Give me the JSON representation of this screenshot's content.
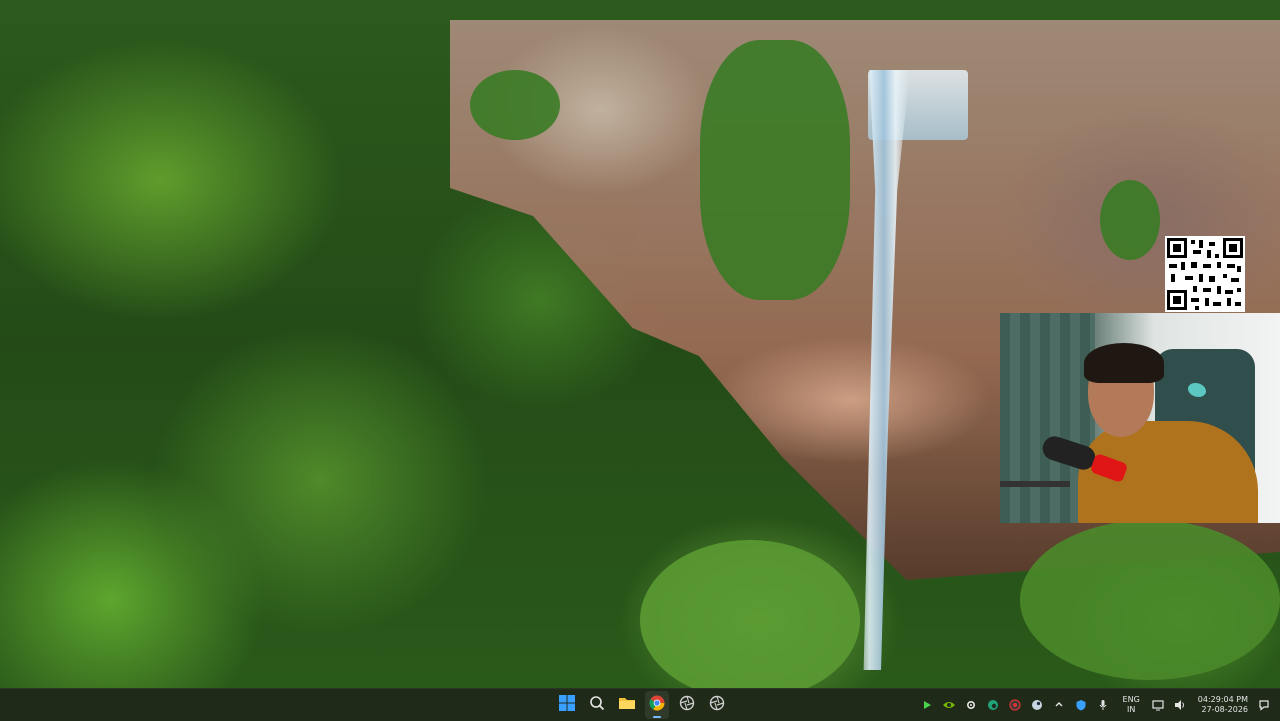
{
  "desktop": {
    "wallpaper": "waterfall-forest",
    "overlays": {
      "qr_code": "qr-code",
      "webcam": "webcam-feed"
    }
  },
  "taskbar": {
    "pinned": [
      {
        "name": "start",
        "icon": "windows-start-icon"
      },
      {
        "name": "search",
        "icon": "search-icon"
      },
      {
        "name": "file-explorer",
        "icon": "folder-icon"
      },
      {
        "name": "chrome",
        "icon": "chrome-icon",
        "active": true
      },
      {
        "name": "app-1",
        "icon": "aperture-icon"
      },
      {
        "name": "app-2",
        "icon": "aperture-icon"
      }
    ],
    "tray": {
      "icons": [
        "play-icon",
        "nvidia-icon",
        "gear-icon",
        "edge-icon",
        "record-icon",
        "steam-icon",
        "chevron-icon",
        "defender-icon",
        "microphone-icon"
      ],
      "language": {
        "line1": "ENG",
        "line2": "IN"
      },
      "clock": {
        "time": "04:29:04 PM",
        "date": "27-08-2026"
      },
      "system_icons": [
        "monitor-icon",
        "volume-icon",
        "notification-icon"
      ]
    },
    "colors": {
      "background": "#1f2a19",
      "accent": "#7db8ff"
    }
  }
}
